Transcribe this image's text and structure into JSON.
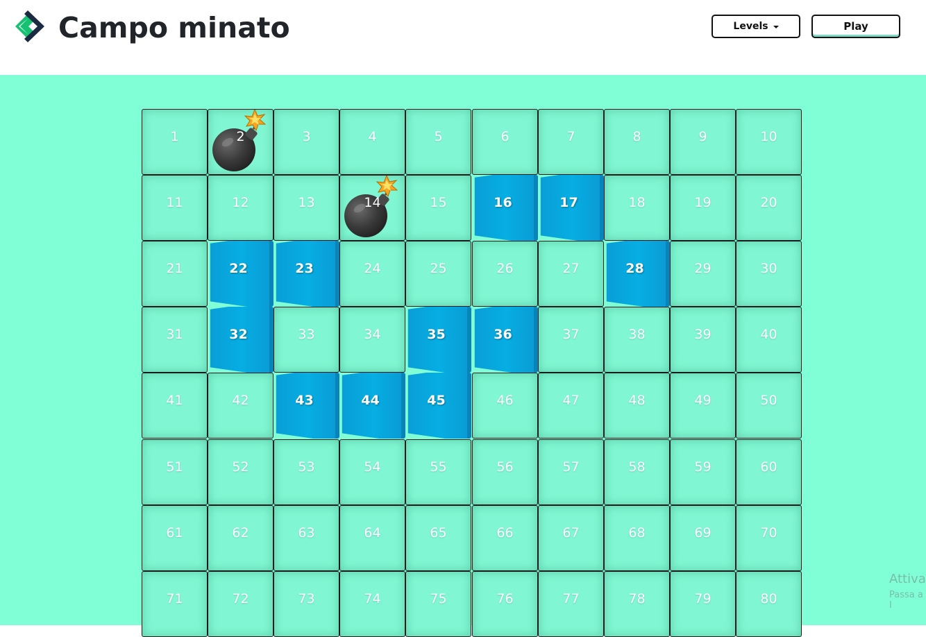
{
  "header": {
    "title": "Campo minato",
    "levels_label": "Levels",
    "play_label": "Play"
  },
  "board": {
    "columns": 10,
    "visible_rows": 8,
    "cells": [
      1,
      2,
      3,
      4,
      5,
      6,
      7,
      8,
      9,
      10,
      11,
      12,
      13,
      14,
      15,
      16,
      17,
      18,
      19,
      20,
      21,
      22,
      23,
      24,
      25,
      26,
      27,
      28,
      29,
      30,
      31,
      32,
      33,
      34,
      35,
      36,
      37,
      38,
      39,
      40,
      41,
      42,
      43,
      44,
      45,
      46,
      47,
      48,
      49,
      50,
      51,
      52,
      53,
      54,
      55,
      56,
      57,
      58,
      59,
      60,
      61,
      62,
      63,
      64,
      65,
      66,
      67,
      68,
      69,
      70,
      71,
      72,
      73,
      74,
      75,
      76,
      77,
      78,
      79,
      80
    ],
    "revealed_cells": [
      16,
      17,
      22,
      23,
      28,
      32,
      35,
      36,
      43,
      44,
      45
    ],
    "bomb_cells": [
      2,
      14
    ],
    "bomb_icon": "bomb-icon"
  },
  "watermark": {
    "line1": "Attiva",
    "line2": "Passa a I"
  },
  "colors": {
    "field_background": "#80ffd6",
    "cell_background": "#80f7d2",
    "revealed_cell": "#06aee3",
    "logo_green": "#16c172",
    "logo_navy": "#1b2a41"
  }
}
